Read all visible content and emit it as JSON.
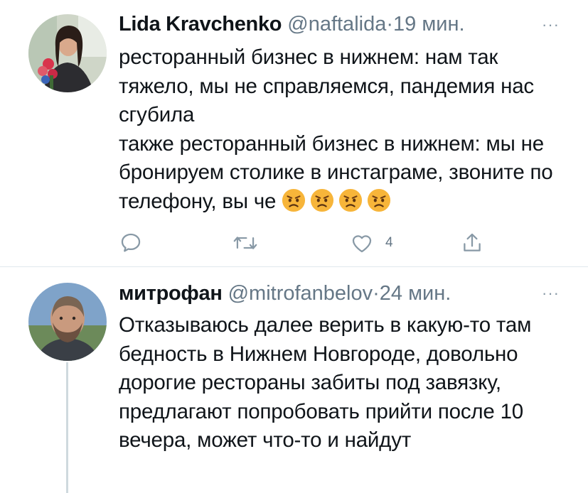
{
  "tweets": [
    {
      "name": "Lida Kravchenko",
      "handle": "@naftalida",
      "separator": "·",
      "time": "19 мин.",
      "more": "···",
      "text": "ресторанный бизнес в нижнем: нам так тяжело, мы не справляемся, пандемия нас сгубила\nтакже ресторанный бизнес в нижнем: мы не бронируем столике в инстаграме, звоните по телефону, вы че ",
      "emojis": [
        "angry-face-icon",
        "angry-face-icon",
        "angry-face-icon",
        "angry-face-icon"
      ],
      "actions": {
        "reply_count": "",
        "retweet_count": "",
        "like_count": "4"
      }
    },
    {
      "name": "митрофан",
      "handle": "@mitrofanbelov",
      "separator": "·",
      "time": "24 мин.",
      "more": "···",
      "text": "Отказываюсь далее верить в какую-то там бедность в Нижнем Новгороде, довольно дорогие рестораны забиты под завязку, предлагают попробовать прийти после 10 вечера, может что-то и найдут"
    }
  ],
  "colors": {
    "text": "#0f1419",
    "secondary": "#657786",
    "icon": "#8899a6",
    "divider": "#e1e8ed"
  }
}
